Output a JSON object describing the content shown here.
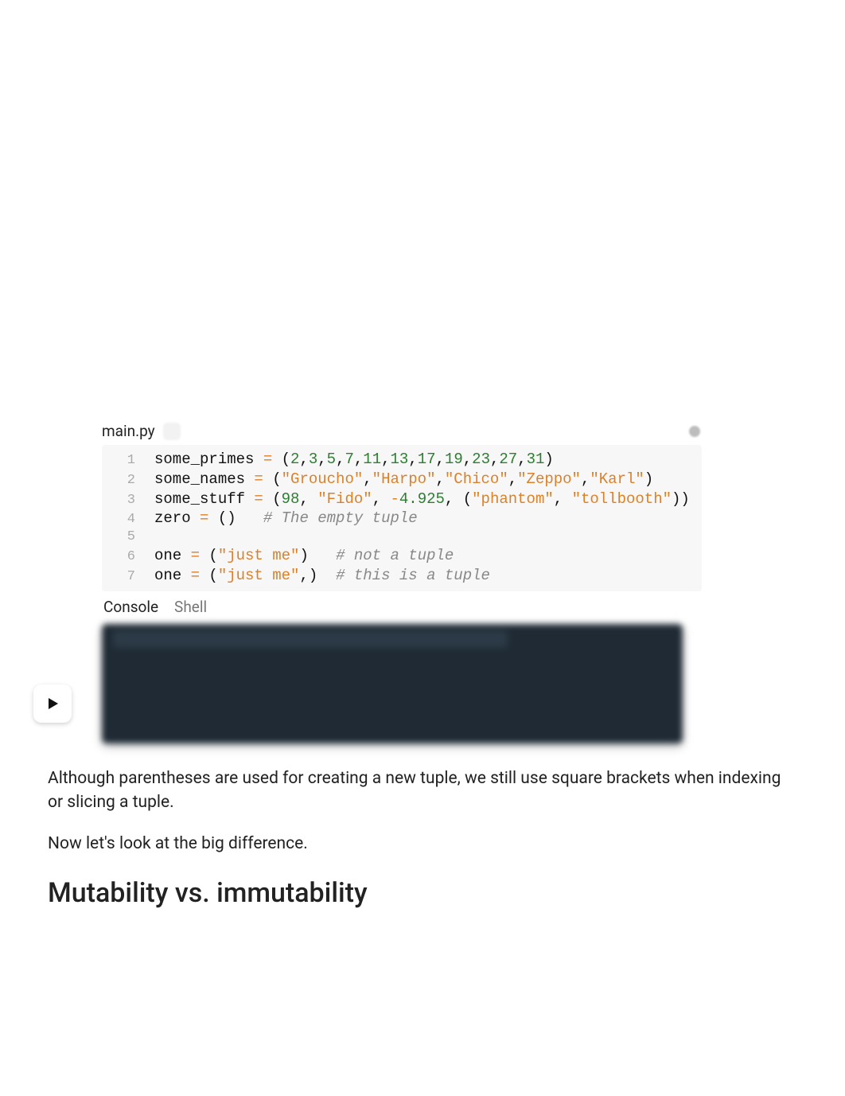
{
  "editor": {
    "filename": "main.py",
    "tabs": {
      "console": "Console",
      "shell": "Shell"
    }
  },
  "code": {
    "lines": [
      {
        "n": "1",
        "tokens": [
          {
            "t": "some_primes ",
            "c": "tok-id"
          },
          {
            "t": "=",
            "c": "tok-eq"
          },
          {
            "t": " (",
            "c": "tok-punc"
          },
          {
            "t": "2",
            "c": "tok-num"
          },
          {
            "t": ",",
            "c": "tok-punc"
          },
          {
            "t": "3",
            "c": "tok-num"
          },
          {
            "t": ",",
            "c": "tok-punc"
          },
          {
            "t": "5",
            "c": "tok-num"
          },
          {
            "t": ",",
            "c": "tok-punc"
          },
          {
            "t": "7",
            "c": "tok-num"
          },
          {
            "t": ",",
            "c": "tok-punc"
          },
          {
            "t": "11",
            "c": "tok-num"
          },
          {
            "t": ",",
            "c": "tok-punc"
          },
          {
            "t": "13",
            "c": "tok-num"
          },
          {
            "t": ",",
            "c": "tok-punc"
          },
          {
            "t": "17",
            "c": "tok-num"
          },
          {
            "t": ",",
            "c": "tok-punc"
          },
          {
            "t": "19",
            "c": "tok-num"
          },
          {
            "t": ",",
            "c": "tok-punc"
          },
          {
            "t": "23",
            "c": "tok-num"
          },
          {
            "t": ",",
            "c": "tok-punc"
          },
          {
            "t": "27",
            "c": "tok-num"
          },
          {
            "t": ",",
            "c": "tok-punc"
          },
          {
            "t": "31",
            "c": "tok-num"
          },
          {
            "t": ")",
            "c": "tok-punc"
          }
        ]
      },
      {
        "n": "2",
        "tokens": [
          {
            "t": "some_names ",
            "c": "tok-id"
          },
          {
            "t": "=",
            "c": "tok-eq"
          },
          {
            "t": " (",
            "c": "tok-punc"
          },
          {
            "t": "\"Groucho\"",
            "c": "tok-str"
          },
          {
            "t": ",",
            "c": "tok-punc"
          },
          {
            "t": "\"Harpo\"",
            "c": "tok-str"
          },
          {
            "t": ",",
            "c": "tok-punc"
          },
          {
            "t": "\"Chico\"",
            "c": "tok-str"
          },
          {
            "t": ",",
            "c": "tok-punc"
          },
          {
            "t": "\"Zeppo\"",
            "c": "tok-str"
          },
          {
            "t": ",",
            "c": "tok-punc"
          },
          {
            "t": "\"Karl\"",
            "c": "tok-str"
          },
          {
            "t": ")",
            "c": "tok-punc"
          }
        ]
      },
      {
        "n": "3",
        "tokens": [
          {
            "t": "some_stuff ",
            "c": "tok-id"
          },
          {
            "t": "=",
            "c": "tok-eq"
          },
          {
            "t": " (",
            "c": "tok-punc"
          },
          {
            "t": "98",
            "c": "tok-num"
          },
          {
            "t": ", ",
            "c": "tok-punc"
          },
          {
            "t": "\"Fido\"",
            "c": "tok-str"
          },
          {
            "t": ", ",
            "c": "tok-punc"
          },
          {
            "t": "-",
            "c": "tok-neg"
          },
          {
            "t": "4.925",
            "c": "tok-num"
          },
          {
            "t": ", (",
            "c": "tok-punc"
          },
          {
            "t": "\"phantom\"",
            "c": "tok-str"
          },
          {
            "t": ", ",
            "c": "tok-punc"
          },
          {
            "t": "\"tollbooth\"",
            "c": "tok-str"
          },
          {
            "t": "))",
            "c": "tok-punc"
          }
        ]
      },
      {
        "n": "4",
        "tokens": [
          {
            "t": "zero ",
            "c": "tok-id"
          },
          {
            "t": "=",
            "c": "tok-eq"
          },
          {
            "t": " ()   ",
            "c": "tok-punc"
          },
          {
            "t": "# The empty tuple",
            "c": "tok-cm"
          }
        ]
      },
      {
        "n": "5",
        "tokens": [
          {
            "t": "",
            "c": "tok-id"
          }
        ]
      },
      {
        "n": "6",
        "tokens": [
          {
            "t": "one ",
            "c": "tok-id"
          },
          {
            "t": "=",
            "c": "tok-eq"
          },
          {
            "t": " (",
            "c": "tok-punc"
          },
          {
            "t": "\"just me\"",
            "c": "tok-str"
          },
          {
            "t": ")   ",
            "c": "tok-punc"
          },
          {
            "t": "# not a tuple",
            "c": "tok-cm"
          }
        ]
      },
      {
        "n": "7",
        "tokens": [
          {
            "t": "one ",
            "c": "tok-id"
          },
          {
            "t": "=",
            "c": "tok-eq"
          },
          {
            "t": " (",
            "c": "tok-punc"
          },
          {
            "t": "\"just me\"",
            "c": "tok-str"
          },
          {
            "t": ",)  ",
            "c": "tok-punc"
          },
          {
            "t": "# this is a tuple",
            "c": "tok-cm"
          }
        ]
      }
    ]
  },
  "prose": {
    "p1": "Although parentheses are used for creating a new tuple, we still use square brackets when indexing or slicing a tuple.",
    "p2": "Now let's look at the big difference."
  },
  "heading": "Mutability vs. immutability"
}
